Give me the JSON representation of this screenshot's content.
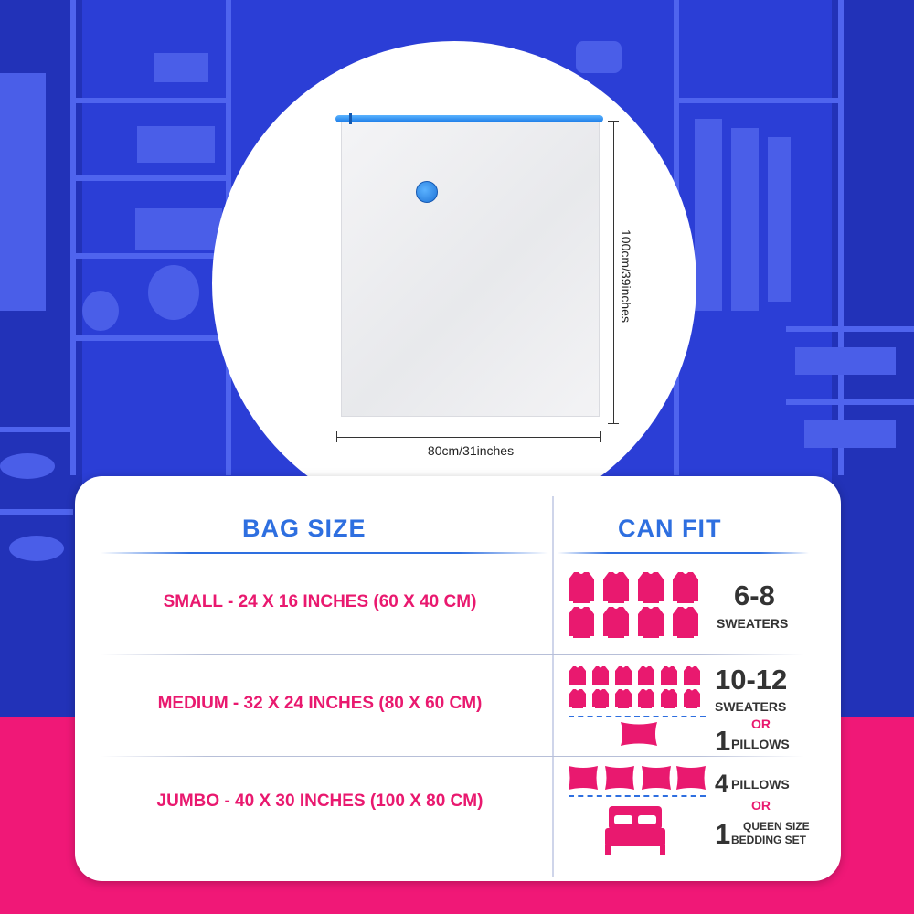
{
  "diagram": {
    "height_label": "100cm/39inches",
    "width_label": "80cm/31inches"
  },
  "table": {
    "col1_header": "BAG SIZE",
    "col2_header": "CAN FIT",
    "rows": [
      {
        "size": "SMALL - 24 X 16 INCHES (60 X 40 CM)",
        "fit_count": "6-8",
        "fit_unit": "SWEATERS"
      },
      {
        "size": "MEDIUM - 32 X 24 INCHES (80 X 60 CM)",
        "fit_count": "10-12",
        "fit_unit": "SWEATERS",
        "or": "OR",
        "alt_count": "1",
        "alt_unit": "PILLOWS"
      },
      {
        "size": "JUMBO - 40 X 30 INCHES (100 X 80 CM)",
        "fit_count": "4",
        "fit_unit": "PILLOWS",
        "or": "OR",
        "alt_count": "1",
        "alt_unit_line1": "QUEEN SIZE",
        "alt_unit_line2": "BEDDING SET"
      }
    ]
  },
  "colors": {
    "accent_blue": "#2e6fe0",
    "accent_pink": "#e9196f",
    "background_blue": "#2a3fd8",
    "background_pink": "#f01877"
  },
  "icons": [
    "sweater-icon",
    "pillow-icon",
    "bed-icon"
  ]
}
